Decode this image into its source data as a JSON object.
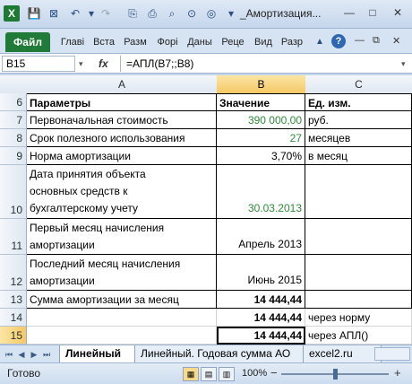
{
  "window": {
    "title": "_Амортизация...",
    "app_icon_letter": "X"
  },
  "ribbon": {
    "file_tab": "Файл",
    "tabs": [
      "Главі",
      "Вста",
      "Разм",
      "Форі",
      "Даны",
      "Реце",
      "Вид",
      "Разр"
    ]
  },
  "formula_bar": {
    "name_box": "B15",
    "fx": "fx",
    "formula": "=АПЛ(B7;;B8)"
  },
  "grid": {
    "columns": [
      "A",
      "B",
      "C"
    ],
    "rows": [
      {
        "num": "6",
        "a": "Параметры",
        "b": "Значение",
        "c": "Ед. изм."
      },
      {
        "num": "7",
        "a": "Первоначальная стоимость",
        "b": "390 000,00",
        "c": "руб."
      },
      {
        "num": "8",
        "a": "Срок полезного использования",
        "b": "27",
        "c": "месяцев"
      },
      {
        "num": "9",
        "a": "Норма амортизации",
        "b": "3,70%",
        "c": "в месяц"
      },
      {
        "num": "10",
        "a1": "Дата принятия объекта",
        "a2": "основных средств к",
        "a3": "бухгалтерскому учету",
        "b": "30.03.2013",
        "c": ""
      },
      {
        "num": "11",
        "a1": "Первый месяц начисления",
        "a2": "амортизации",
        "b": "Апрель 2013",
        "c": ""
      },
      {
        "num": "12",
        "a1": "Последний месяц начисления",
        "a2": "амортизации",
        "b": "Июнь 2015",
        "c": ""
      },
      {
        "num": "13",
        "a": "Сумма амортизации за месяц",
        "b": "14 444,44",
        "c": ""
      },
      {
        "num": "14",
        "a": "",
        "b": "14 444,44",
        "c": "через норму"
      },
      {
        "num": "15",
        "a": "",
        "b": "14 444,44",
        "c": "через АПЛ()"
      }
    ]
  },
  "sheet_tabs": {
    "tabs": [
      "Линейный",
      "Линейный. Годовая сумма АО",
      "excel2.ru"
    ],
    "active": 0
  },
  "status_bar": {
    "status": "Готово",
    "zoom": "100%",
    "zoom_level": 0.5
  }
}
